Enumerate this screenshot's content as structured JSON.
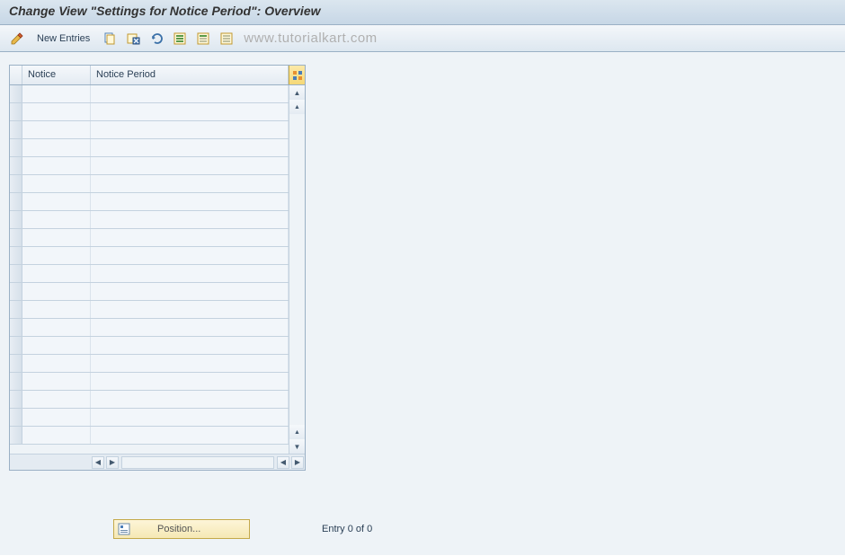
{
  "header": {
    "title": "Change View \"Settings for Notice Period\": Overview"
  },
  "toolbar": {
    "new_entries_label": "New Entries",
    "icons": {
      "pencil": "pencil-icon",
      "copy": "copy-icon",
      "delete": "delete-icon",
      "undo": "undo-icon",
      "select_all": "select-all-icon",
      "select_block": "select-block-icon",
      "deselect": "deselect-icon"
    }
  },
  "watermark": "www.tutorialkart.com",
  "table": {
    "columns": {
      "notice": "Notice",
      "period": "Notice Period"
    },
    "row_count": 20,
    "config_icon": "table-config-icon"
  },
  "footer": {
    "position_label": "Position...",
    "entry_status": "Entry 0 of 0"
  },
  "colors": {
    "header_bg": "#d3e0eb",
    "toolbar_bg": "#e8eff6",
    "content_bg": "#eef3f7",
    "border": "#9ab0c5",
    "gold": "#f5e8b4"
  }
}
